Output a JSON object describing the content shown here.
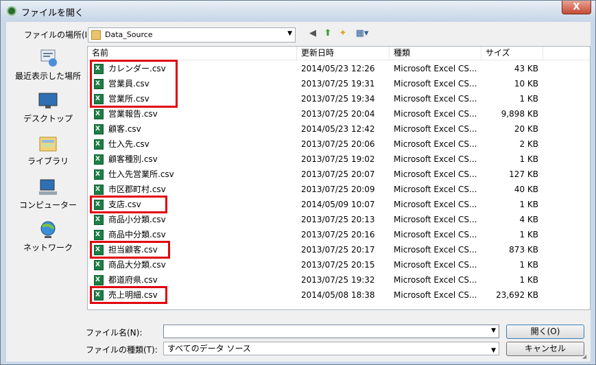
{
  "window": {
    "title": "ファイルを開く",
    "close_label": "X"
  },
  "lookin": {
    "label": "ファイルの場所(I):",
    "value": "Data_Source"
  },
  "places": [
    {
      "label": "最近表示した場所",
      "icon": "recent-places-icon"
    },
    {
      "label": "デスクトップ",
      "icon": "desktop-icon"
    },
    {
      "label": "ライブラリ",
      "icon": "libraries-icon"
    },
    {
      "label": "コンピューター",
      "icon": "computer-icon"
    },
    {
      "label": "ネットワーク",
      "icon": "network-icon"
    }
  ],
  "columns": [
    "名前",
    "更新日時",
    "種類",
    "サイズ"
  ],
  "files": [
    {
      "name": "カレンダー.csv",
      "date": "2014/05/23 12:26",
      "type": "Microsoft Excel CS...",
      "size": "43 KB"
    },
    {
      "name": "営業員.csv",
      "date": "2013/07/25 19:31",
      "type": "Microsoft Excel CS...",
      "size": "10 KB"
    },
    {
      "name": "営業所.csv",
      "date": "2013/07/25 19:34",
      "type": "Microsoft Excel CS...",
      "size": "1 KB"
    },
    {
      "name": "営業報告.csv",
      "date": "2013/07/25 20:04",
      "type": "Microsoft Excel CS...",
      "size": "9,898 KB"
    },
    {
      "name": "顧客.csv",
      "date": "2014/05/23 12:42",
      "type": "Microsoft Excel CS...",
      "size": "20 KB"
    },
    {
      "name": "仕入先.csv",
      "date": "2013/07/25 20:06",
      "type": "Microsoft Excel CS...",
      "size": "2 KB"
    },
    {
      "name": "顧客種別.csv",
      "date": "2013/07/25 19:02",
      "type": "Microsoft Excel CS...",
      "size": "1 KB"
    },
    {
      "name": "仕入先営業所.csv",
      "date": "2013/07/25 20:07",
      "type": "Microsoft Excel CS...",
      "size": "127 KB"
    },
    {
      "name": "市区郡町村.csv",
      "date": "2013/07/25 20:09",
      "type": "Microsoft Excel CS...",
      "size": "40 KB"
    },
    {
      "name": "支店.csv",
      "date": "2014/05/09 10:07",
      "type": "Microsoft Excel CS...",
      "size": "1 KB"
    },
    {
      "name": "商品小分類.csv",
      "date": "2013/07/25 20:13",
      "type": "Microsoft Excel CS...",
      "size": "4 KB"
    },
    {
      "name": "商品中分類.csv",
      "date": "2013/07/25 20:16",
      "type": "Microsoft Excel CS...",
      "size": "1 KB"
    },
    {
      "name": "担当顧客.csv",
      "date": "2013/07/25 20:17",
      "type": "Microsoft Excel CS...",
      "size": "873 KB"
    },
    {
      "name": "商品大分類.csv",
      "date": "2013/07/25 20:15",
      "type": "Microsoft Excel CS...",
      "size": "1 KB"
    },
    {
      "name": "都道府県.csv",
      "date": "2013/07/25 19:32",
      "type": "Microsoft Excel CS...",
      "size": "1 KB"
    },
    {
      "name": "売上明細.csv",
      "date": "2014/05/08 18:38",
      "type": "Microsoft Excel CS...",
      "size": "23,692 KB"
    }
  ],
  "filename": {
    "label": "ファイル名(N):",
    "value": ""
  },
  "filetype": {
    "label": "ファイルの種類(T):",
    "value": "すべてのデータ ソース"
  },
  "buttons": {
    "open": "開く(O)",
    "cancel": "キャンセル"
  },
  "highlight_color": "#e0000a"
}
